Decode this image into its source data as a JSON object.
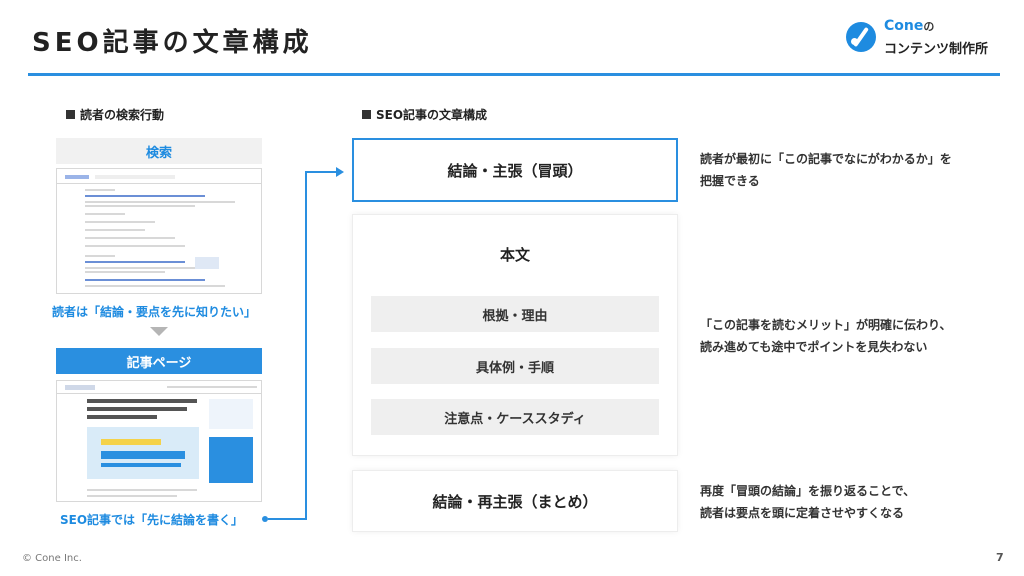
{
  "header": {
    "title": "SEO記事の文章構成",
    "logo": {
      "top": "Cone",
      "top_suffix": "の",
      "bottom": "コンテンツ制作所"
    }
  },
  "left": {
    "section_label": "読者の検索行動",
    "search_label": "検索",
    "reader_caption": "読者は「結論・要点を先に知りたい」",
    "article_label": "記事ページ",
    "seo_caption": "SEO記事では「先に結論を書く」"
  },
  "middle": {
    "section_label": "SEO記事の文章構成",
    "conclusion": "結論・主張（冒頭）",
    "body_title": "本文",
    "body_items": [
      "根拠・理由",
      "具体例・手順",
      "注意点・ケーススタディ"
    ],
    "reconclusion": "結論・再主張（まとめ）"
  },
  "notes": {
    "note1": [
      "読者が最初に「この記事でなにがわかるか」を",
      "把握できる"
    ],
    "note2": [
      "「この記事を読むメリット」が明確に伝わり、",
      "読み進めても途中でポイントを見失わない"
    ],
    "note3": [
      "再度「冒頭の結論」を振り返ることで、",
      "読者は要点を頭に定着させやすくなる"
    ]
  },
  "footer": {
    "copyright": "© Cone Inc.",
    "page": "7"
  },
  "colors": {
    "accent": "#2a8fe0",
    "text": "#333333",
    "panel": "#efefef"
  }
}
